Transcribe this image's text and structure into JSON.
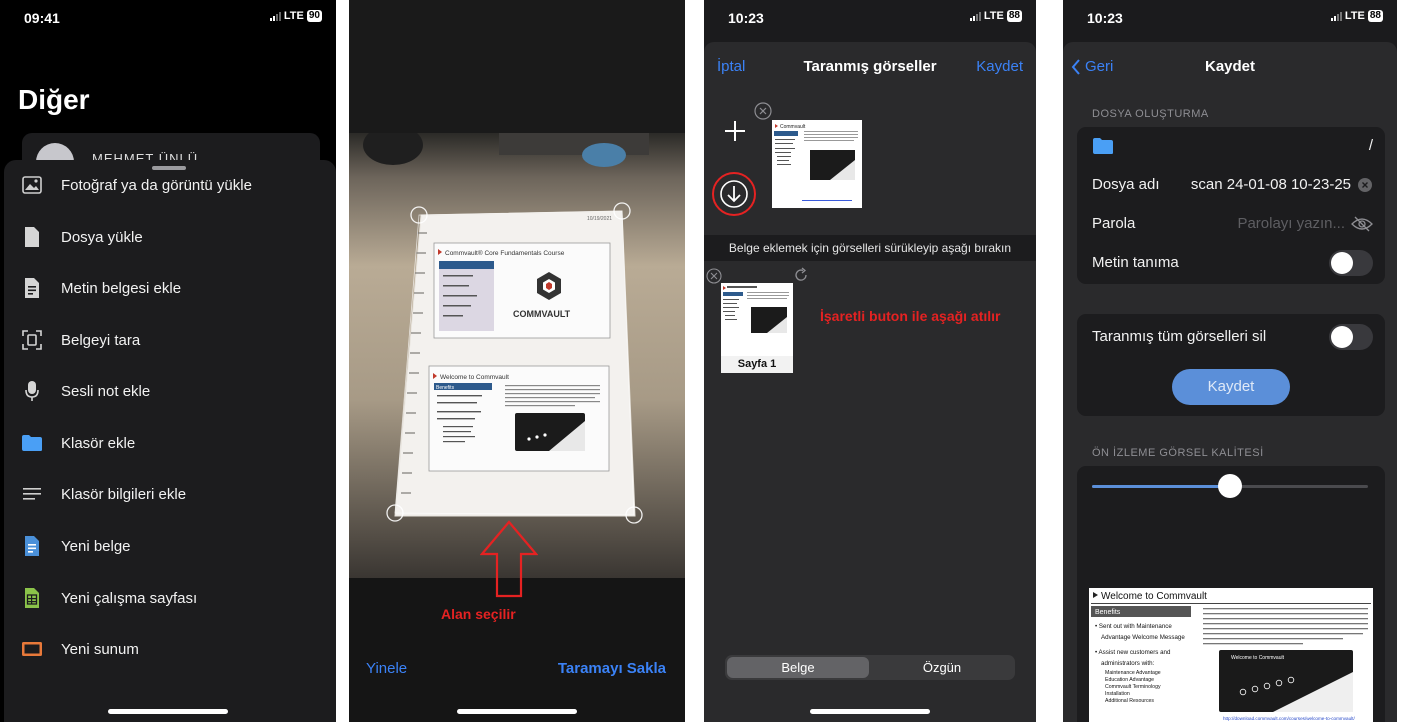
{
  "phone1": {
    "time": "09:41",
    "network": "LTE",
    "battery": "90",
    "title": "Diğer",
    "user_name": "MEHMET ÜNLÜ",
    "menu": [
      {
        "label": "Fotoğraf ya da görüntü yükle",
        "icon": "image-icon"
      },
      {
        "label": "Dosya yükle",
        "icon": "file-icon"
      },
      {
        "label": "Metin belgesi ekle",
        "icon": "text-document-icon"
      },
      {
        "label": "Belgeyi tara",
        "icon": "scan-document-icon"
      },
      {
        "label": "Sesli not ekle",
        "icon": "microphone-icon"
      },
      {
        "label": "Klasör ekle",
        "icon": "folder-icon"
      },
      {
        "label": "Klasör bilgileri ekle",
        "icon": "lines-icon"
      },
      {
        "label": "Yeni belge",
        "icon": "new-document-icon"
      },
      {
        "label": "Yeni çalışma sayfası",
        "icon": "spreadsheet-icon"
      },
      {
        "label": "Yeni sunum",
        "icon": "presentation-icon"
      }
    ],
    "colors": {
      "doc_blue": "#4a90d9",
      "sheet_green": "#8bc34a",
      "slide_orange": "#e8793a",
      "folder_blue": "#4a9ff5"
    }
  },
  "phone2": {
    "doc": {
      "header_title": "Commvault® Core Fundamentals Course",
      "logo_text": "COMMVAULT",
      "page_date": "10/19/2021",
      "lower_title": "Welcome to Commvault",
      "lower_heading": "Benefits"
    },
    "annotation": "Alan seçilir",
    "retake_label": "Yinele",
    "save_scan_label": "Taramayı Sakla",
    "annotation_color": "#e52222"
  },
  "phone3": {
    "time": "10:23",
    "network": "LTE",
    "battery": "88",
    "cancel_label": "İptal",
    "title": "Taranmış görseller",
    "save_label": "Kaydet",
    "thumb_title": "Commvault",
    "hint": "Belge eklemek için görselleri sürükleyip aşağı bırakın",
    "page_label": "Sayfa 1",
    "annotation": "İşaretli buton ile aşağı atılır",
    "segments": {
      "selected": "Belge",
      "other": "Özgün"
    }
  },
  "phone4": {
    "time": "10:23",
    "network": "LTE",
    "battery": "88",
    "back_label": "Geri",
    "title": "Kaydet",
    "section_file": "DOSYA OLUŞTURMA",
    "folder_path": "/",
    "file_name_label": "Dosya adı",
    "file_name_value": "scan 24-01-08 10-23-25",
    "password_label": "Parola",
    "password_placeholder": "Parolayı yazın...",
    "ocr_label": "Metin tanıma",
    "delete_all_label": "Taranmış tüm görselleri sil",
    "save_button": "Kaydet",
    "section_quality": "ÖN İZLEME GÖRSEL KALİTESİ",
    "quality_level": 0.5,
    "preview": {
      "title": "Welcome to Commvault",
      "benefits": "Benefits",
      "bullet1": "Sent out with Maintenance Advantage Welcome Message",
      "bullet2": "Assist new customers and administrators with:",
      "sub": [
        "Maintenance Advantage",
        "Education Advantage",
        "Commvault Terminology",
        "Installation",
        "Additional Resources"
      ],
      "video_title": "Welcome to Commvault",
      "link": "http://download.commvault.com/courses/welcome-to-commvault/"
    }
  }
}
